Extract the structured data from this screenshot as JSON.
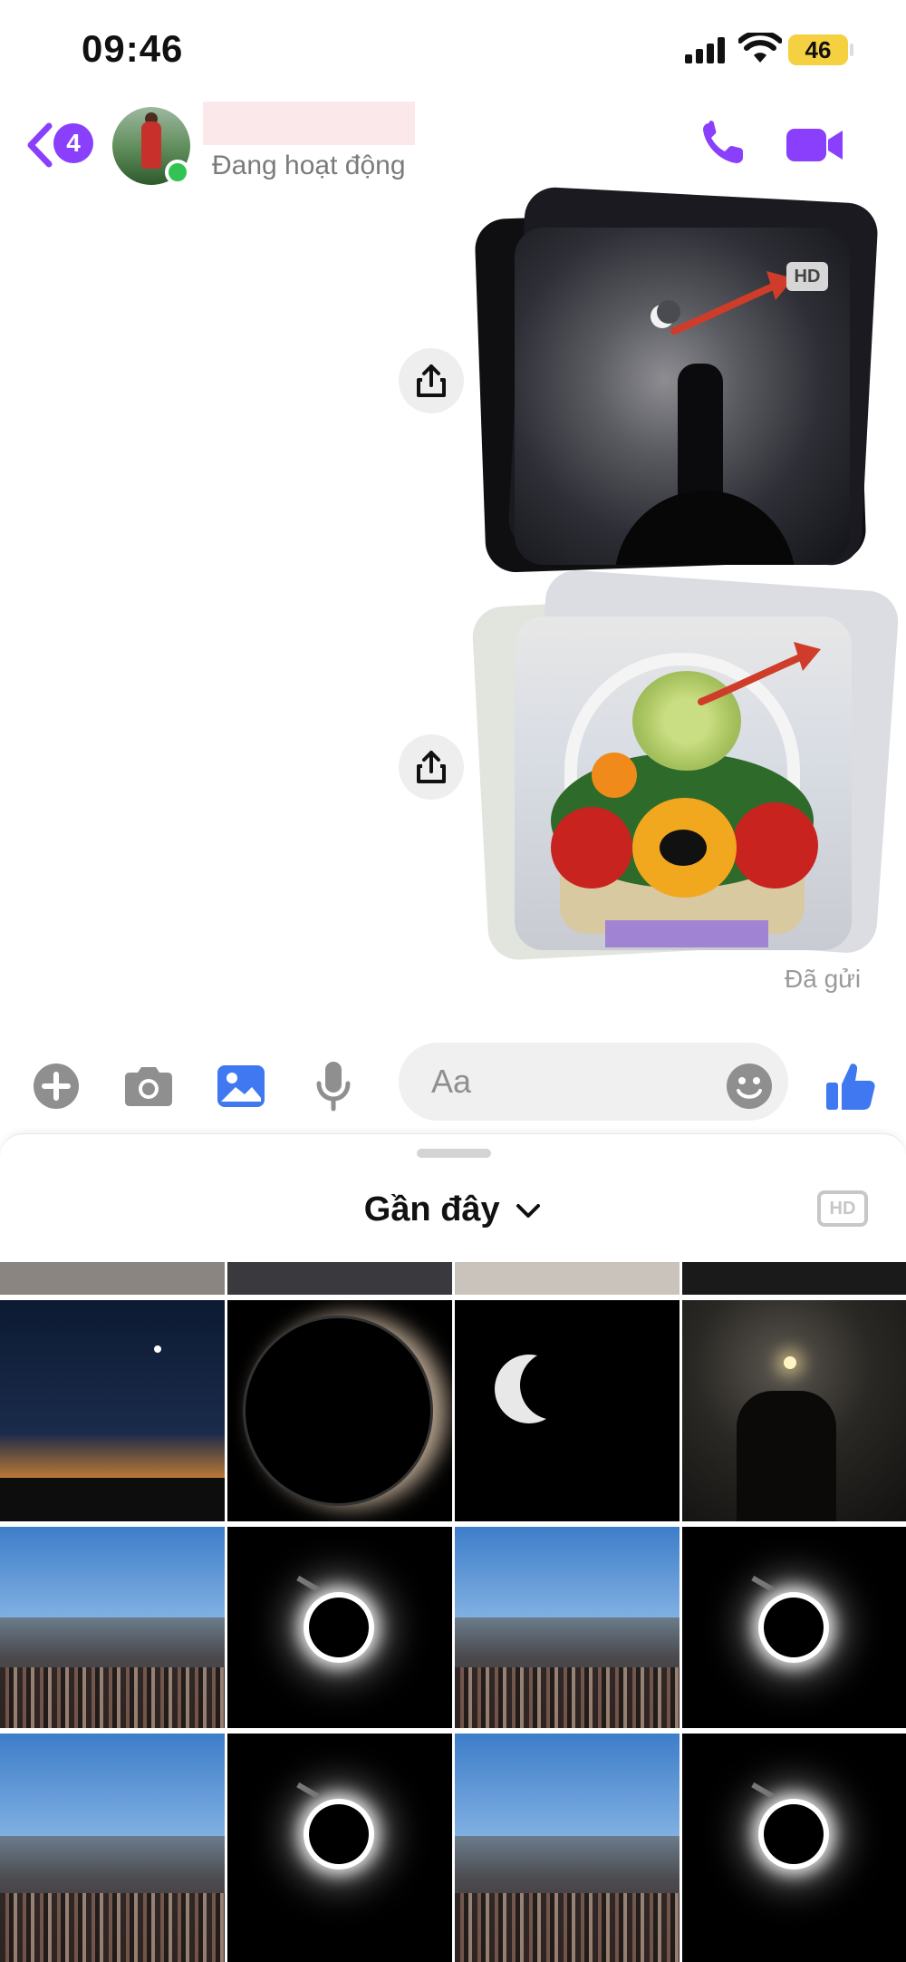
{
  "status_bar": {
    "time": "09:46",
    "battery": "46"
  },
  "header": {
    "back_badge": "4",
    "status": "Đang hoạt động",
    "colors": {
      "accent": "#8a3ffc",
      "online": "#31c453"
    }
  },
  "messages": {
    "photo_1_hd_label": "HD",
    "sent_label": "Đã gửi"
  },
  "composer": {
    "placeholder": "Aa"
  },
  "gallery": {
    "title": "Gần đây",
    "hd_label": "HD"
  },
  "icons": {
    "back": "chevron-left-icon",
    "call": "phone-icon",
    "video": "video-camera-icon",
    "share": "share-icon",
    "plus": "plus-circle-icon",
    "camera": "camera-icon",
    "gallery": "image-icon",
    "mic": "microphone-icon",
    "emoji": "smiley-icon",
    "like": "thumbs-up-icon"
  }
}
